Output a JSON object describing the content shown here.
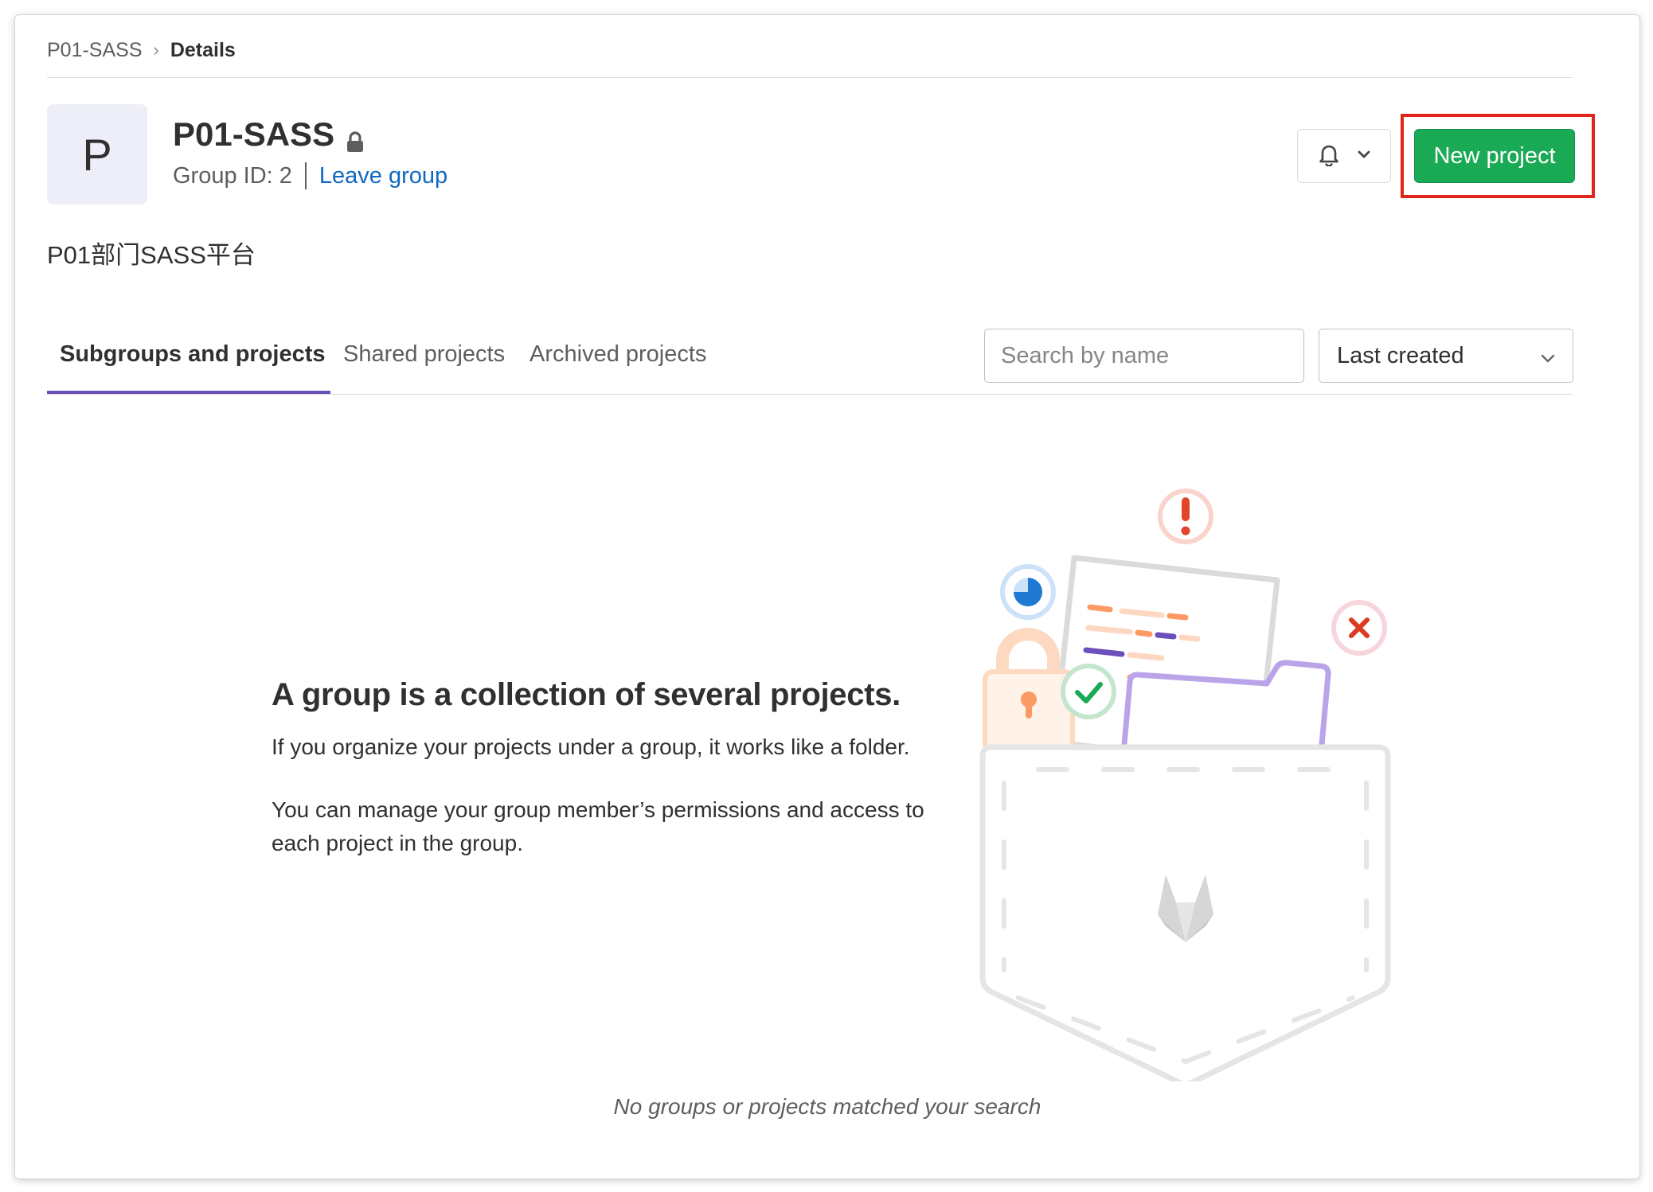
{
  "breadcrumb": {
    "parent": "P01-SASS",
    "separator": "›",
    "current": "Details"
  },
  "group": {
    "avatar_letter": "P",
    "name": "P01-SASS",
    "visibility_icon": "lock-icon",
    "group_id": "Group ID: 2",
    "leave_label": "Leave group",
    "description": "P01部门SASS平台"
  },
  "header_actions": {
    "notification_icon": "bell-icon",
    "new_project_label": "New project"
  },
  "tabs": [
    {
      "label": "Subgroups and projects",
      "active": true
    },
    {
      "label": "Shared projects",
      "active": false
    },
    {
      "label": "Archived projects",
      "active": false
    }
  ],
  "filters": {
    "search_placeholder": "Search by name",
    "search_value": "",
    "sort_selected": "Last created"
  },
  "empty_state": {
    "title": "A group is a collection of several projects.",
    "paragraph1": "If you organize your projects under a group, it works like a folder.",
    "paragraph2": "You can manage your group member’s permissions and access to each project in the group.",
    "no_results": "No groups or projects matched your search"
  },
  "colors": {
    "primary_green": "#1aaa55",
    "link_blue": "#1068bf",
    "tab_underline": "#6b4fbb",
    "highlight_red": "#e1251b"
  }
}
